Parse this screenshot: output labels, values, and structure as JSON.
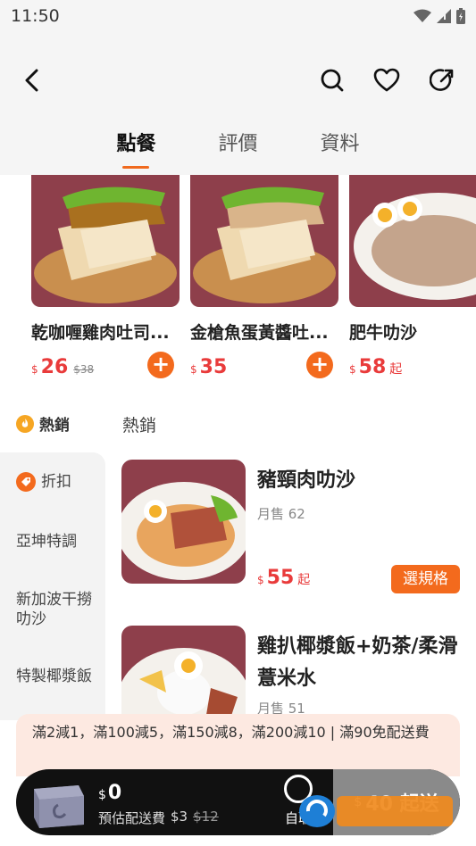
{
  "status_bar": {
    "time": "11:50"
  },
  "tabs": [
    {
      "label": "點餐",
      "active": true
    },
    {
      "label": "評價",
      "active": false
    },
    {
      "label": "資料",
      "active": false
    }
  ],
  "featured": [
    {
      "name": "乾咖喱雞肉吐司...",
      "currency": "$",
      "price": "26",
      "original": "$38",
      "suffix": ""
    },
    {
      "name": "金槍魚蛋黃醬吐...",
      "currency": "$",
      "price": "35",
      "original": "",
      "suffix": ""
    },
    {
      "name": "肥牛叻沙",
      "currency": "$",
      "price": "58",
      "original": "",
      "suffix": "起"
    }
  ],
  "category_header": {
    "hot_label": "熱銷",
    "title": "熱銷"
  },
  "sidebar": {
    "discount": "折扣",
    "items": [
      "亞坤特調",
      "新加波干撈叻沙",
      "特製椰漿飯"
    ]
  },
  "products": [
    {
      "title": "豬頸肉叻沙",
      "sold": "月售 62",
      "currency": "$",
      "price": "55",
      "suffix": "起",
      "button": "選規格"
    },
    {
      "title": "雞扒椰漿飯+奶茶/柔滑薏米水",
      "sold": "月售 51"
    }
  ],
  "promo": {
    "text": "滿2減1，滿100減5，滿150減8，滿200減10 | 滿90免配送費"
  },
  "cart": {
    "currency": "$",
    "total": "0",
    "fee_label": "預估配送費",
    "fee": "$3",
    "fee_original": "$12",
    "pickup": "自取",
    "min_currency": "$",
    "min_label": "40 起送"
  },
  "colors": {
    "accent": "#f36a1d",
    "price": "#e93b3b",
    "promo_bg": "#fde9e1"
  }
}
